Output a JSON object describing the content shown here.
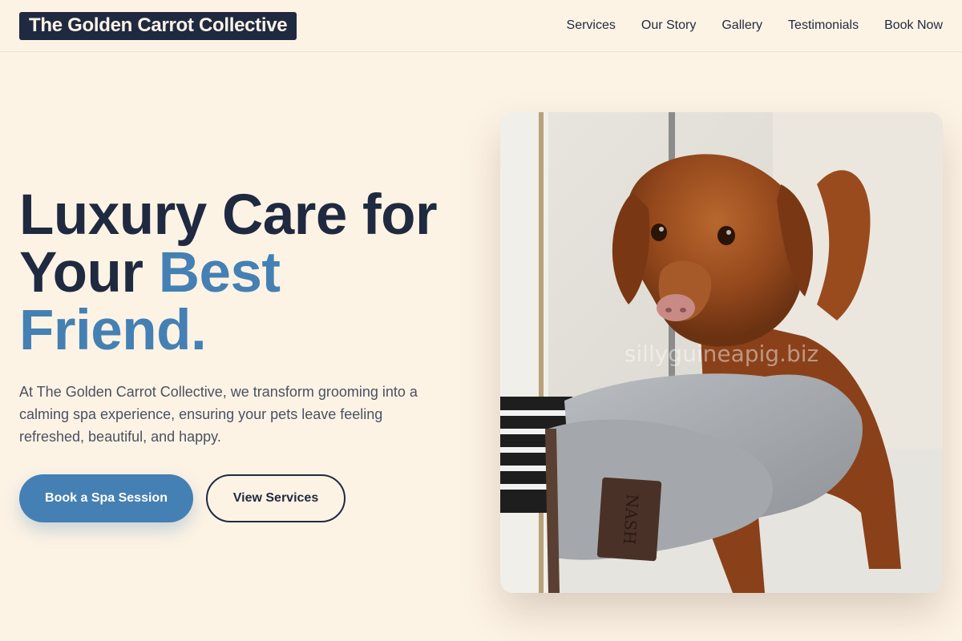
{
  "header": {
    "brand": "The Golden Carrot Collective",
    "nav": [
      "Services",
      "Our Story",
      "Gallery",
      "Testimonials",
      "Book Now"
    ]
  },
  "hero": {
    "headline_line1": "Luxury Care for",
    "headline_line2_plain": "Your ",
    "headline_line2_accent": "Best",
    "headline_line3_accent": "Friend.",
    "description": "At The Golden Carrot Collective, we transform grooming into a calming spa experience, ensuring your pets leave feeling refreshed, beautiful, and happy.",
    "primary_cta": "Book a Spa Session",
    "secondary_cta": "View Services"
  },
  "image": {
    "subject": "wet brown dog being dried with grey grooming mitts",
    "mitt_label": "NASH",
    "watermark": "sillyguineapig.biz"
  },
  "colors": {
    "background": "#fdf3e5",
    "navy": "#1f2a40",
    "accent_blue": "#4480b3"
  }
}
